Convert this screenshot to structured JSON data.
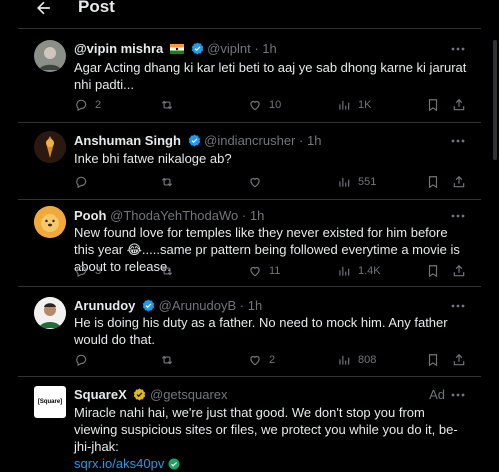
{
  "header": {
    "title": "Post"
  },
  "posts": [
    {
      "name": "@vipin mishra",
      "handle": "@viplnt",
      "time": "1h",
      "text": "Agar Acting dhang ki kar leti beti to aaj ye sab dhong karne ki jarurat nhi padti...",
      "replies": "2",
      "reposts": "",
      "likes": "10",
      "views": "1K"
    },
    {
      "name": "Anshuman Singh",
      "handle": "@indiancrusher",
      "time": "1h",
      "text": "Inke bhi fatwe nikaloge ab?",
      "replies": "",
      "reposts": "",
      "likes": "",
      "views": "551"
    },
    {
      "name": "Pooh",
      "handle": "@ThodaYehThodaWo",
      "time": "1h",
      "text": "New found love for temples like they never existed for him before this year 😂.....same pr pattern being followed everytime a movie is about to release.",
      "replies": "3",
      "reposts": "",
      "likes": "11",
      "views": "1.4K"
    },
    {
      "name": "Arunudoy",
      "handle": "@ArunudoyB",
      "time": "1h",
      "text": "He is doing his duty as a father. No need to mock him. Any father would do that.",
      "replies": "",
      "reposts": "",
      "likes": "2",
      "views": "808"
    },
    {
      "name": "SquareX",
      "handle": "@getsquarex",
      "ad_label": "Ad",
      "avatar_text": "[Square]",
      "text": "Miracle nahi hai, we're just that good. We don't stop you from viewing suspicious sites or files, we protect you while you do it, be-jhi-jhak:",
      "link": "sqrx.io/aks40pv"
    }
  ],
  "colors": {
    "accent": "#1d9bf0",
    "muted": "#71767b",
    "border": "#2f3336"
  }
}
